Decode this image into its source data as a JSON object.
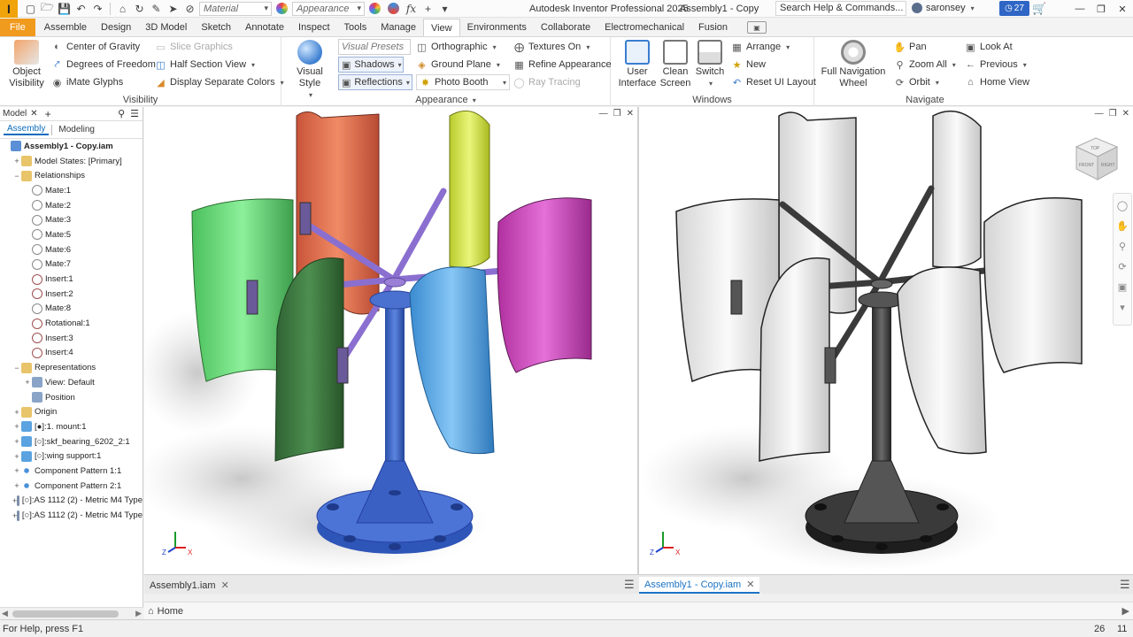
{
  "app": {
    "logo_letter": "I",
    "title": "Autodesk Inventor Professional 2025",
    "document": "Assembly1 - Copy",
    "search_placeholder": "Search Help & Commands...",
    "user": "saronsey",
    "notification_count": "27",
    "qat": {
      "material_placeholder": "Material",
      "appearance_placeholder": "Appearance",
      "fx_label": "fx"
    }
  },
  "ribbon_tabs": [
    "File",
    "Assemble",
    "Design",
    "3D Model",
    "Sketch",
    "Annotate",
    "Inspect",
    "Tools",
    "Manage",
    "View",
    "Environments",
    "Collaborate",
    "Electromechanical",
    "Fusion"
  ],
  "active_tab": "View",
  "ribbon": {
    "visibility": {
      "label": "Visibility",
      "object_visibility": "Object\nVisibility",
      "center_of_gravity": "Center of Gravity",
      "degrees_of_freedom": "Degrees of Freedom",
      "imate_glyphs": "iMate Glyphs",
      "slice_graphics": "Slice Graphics",
      "half_section_view": "Half Section View",
      "display_separate_colors": "Display Separate Colors"
    },
    "appearance": {
      "label": "Appearance",
      "visual_style": "Visual Style",
      "visual_presets": "Visual Presets",
      "shadows": "Shadows",
      "reflections": "Reflections",
      "orthographic": "Orthographic",
      "ground_plane": "Ground Plane",
      "photo_booth": "Photo Booth",
      "textures_on": "Textures On",
      "refine_appearance": "Refine Appearance",
      "ray_tracing": "Ray Tracing"
    },
    "windows": {
      "label": "Windows",
      "user_interface": "User\nInterface",
      "clean_screen": "Clean\nScreen",
      "switch": "Switch",
      "arrange": "Arrange",
      "new": "New",
      "reset_ui_layout": "Reset UI Layout"
    },
    "navigate": {
      "label": "Navigate",
      "full_navigation_wheel": "Full Navigation\nWheel",
      "pan": "Pan",
      "zoom_all": "Zoom All",
      "orbit": "Orbit",
      "look_at": "Look At",
      "previous": "Previous",
      "home_view": "Home View"
    }
  },
  "browser": {
    "title": "Model",
    "modes": [
      "Assembly",
      "Modeling"
    ],
    "tree": [
      {
        "label": "Assembly1 - Copy.iam",
        "icon": "root",
        "indent": 0,
        "bold": true
      },
      {
        "label": "Model States: [Primary]",
        "icon": "folder",
        "indent": 1,
        "exp": "+"
      },
      {
        "label": "Relationships",
        "icon": "folder",
        "indent": 1,
        "exp": "−"
      },
      {
        "label": "Mate:1",
        "icon": "mate",
        "indent": 2
      },
      {
        "label": "Mate:2",
        "icon": "mate",
        "indent": 2
      },
      {
        "label": "Mate:3",
        "icon": "mate",
        "indent": 2
      },
      {
        "label": "Mate:5",
        "icon": "mate",
        "indent": 2
      },
      {
        "label": "Mate:6",
        "icon": "mate",
        "indent": 2
      },
      {
        "label": "Mate:7",
        "icon": "mate",
        "indent": 2
      },
      {
        "label": "Insert:1",
        "icon": "insert",
        "indent": 2
      },
      {
        "label": "Insert:2",
        "icon": "insert",
        "indent": 2
      },
      {
        "label": "Mate:8",
        "icon": "mate",
        "indent": 2
      },
      {
        "label": "Rotational:1",
        "icon": "insert",
        "indent": 2
      },
      {
        "label": "Insert:3",
        "icon": "insert",
        "indent": 2
      },
      {
        "label": "Insert:4",
        "icon": "insert",
        "indent": 2
      },
      {
        "label": "Representations",
        "icon": "folder",
        "indent": 1,
        "exp": "−"
      },
      {
        "label": "View: Default",
        "icon": "view",
        "indent": 2,
        "exp": "+"
      },
      {
        "label": "Position",
        "icon": "view",
        "indent": 2
      },
      {
        "label": "Origin",
        "icon": "folder",
        "indent": 1,
        "exp": "+"
      },
      {
        "label": "[●]:1. mount:1",
        "icon": "comp",
        "indent": 1,
        "exp": "+"
      },
      {
        "label": "[○]:skf_bearing_6202_2:1",
        "icon": "comp",
        "indent": 1,
        "exp": "+"
      },
      {
        "label": "[○]:wing support:1",
        "icon": "comp",
        "indent": 1,
        "exp": "+"
      },
      {
        "label": "Component Pattern 1:1",
        "icon": "pattern",
        "indent": 1,
        "exp": "+"
      },
      {
        "label": "Component Pattern 2:1",
        "icon": "pattern",
        "indent": 1,
        "exp": "+"
      },
      {
        "label": "[○]:AS 1112 (2) - Metric M4  Type",
        "icon": "bolt",
        "indent": 1,
        "exp": "+"
      },
      {
        "label": "[○]:AS 1112 (2) - Metric M4  Type",
        "icon": "bolt",
        "indent": 1,
        "exp": "+"
      }
    ]
  },
  "viewcube": {
    "top": "TOP",
    "front": "FRONT",
    "right": "RIGHT"
  },
  "doc_tabs": [
    {
      "label": "Assembly1.iam",
      "active": false
    },
    {
      "label": "Assembly1 - Copy.iam",
      "active": true
    }
  ],
  "home_label": "Home",
  "status": {
    "help": "For Help, press F1",
    "count_a": "26",
    "count_b": "11"
  },
  "colors": {
    "accent": "#1b73c5",
    "file_tab": "#f09a1e",
    "blade_orange": "#e8744f",
    "blade_yellow": "#d6e84a",
    "blade_magenta": "#d24ac6",
    "blade_green_light": "#6ee07a",
    "blade_green_dark": "#3d7a40",
    "blade_blue": "#55a8e8",
    "frame_purple": "#9b7fd6",
    "mount_blue": "#3a66c8"
  }
}
